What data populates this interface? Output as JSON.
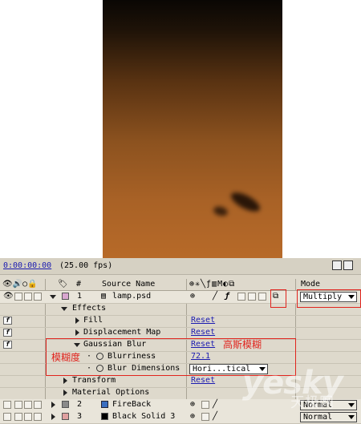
{
  "timeline": {
    "timecode": "0:00:00:00",
    "fps": "(25.00 fps)"
  },
  "columns": {
    "number": "#",
    "source_name": "Source Name",
    "mode": "Mode"
  },
  "layer1": {
    "number": "1",
    "name": "lamp.psd",
    "mode": "Multiply"
  },
  "effects": {
    "group_label": "Effects",
    "fill": {
      "label": "Fill",
      "reset": "Reset"
    },
    "displacement": {
      "label": "Displacement Map",
      "reset": "Reset"
    },
    "gaussian": {
      "label": "Gaussian Blur",
      "reset": "Reset"
    },
    "blurriness": {
      "label": "Blurriness",
      "value": "72.1"
    },
    "blur_dimensions": {
      "label": "Blur Dimensions",
      "value": "Hori...tical"
    }
  },
  "transform": {
    "label": "Transform",
    "reset": "Reset"
  },
  "material": {
    "label": "Material Options"
  },
  "layer2": {
    "number": "2",
    "name": "FireBack",
    "mode": "Normal"
  },
  "layer3": {
    "number": "3",
    "name": "Black Solid 3",
    "mode": "Normal"
  },
  "annotations": {
    "gaussian_cn": "高斯模糊",
    "blurriness_cn": "模糊度"
  },
  "watermark": {
    "brand": "yesky",
    "sub": "天极网"
  },
  "colors": {
    "annotation": "#e0241e",
    "link": "#1a1ab0",
    "layer1_label": "#d9a6cf",
    "layer2_label": "#8a8a8a",
    "layer3_label": "#e0a0a0"
  }
}
